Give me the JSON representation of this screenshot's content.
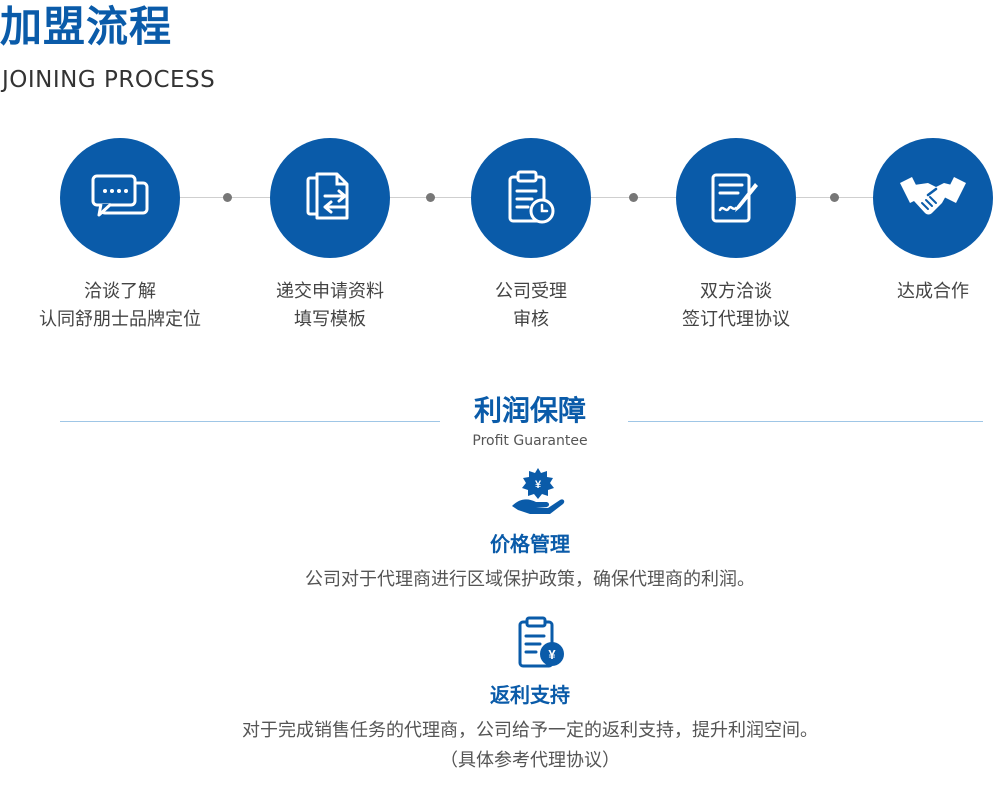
{
  "header": {
    "title_cn": "加盟流程",
    "title_en": "JOINING PROCESS"
  },
  "steps": [
    {
      "icon": "chat-bubbles-icon",
      "line1": "洽谈了解",
      "line2": "认同舒朋士品牌定位"
    },
    {
      "icon": "document-exchange-icon",
      "line1": "递交申请资料",
      "line2": "填写模板"
    },
    {
      "icon": "clipboard-clock-icon",
      "line1": "公司受理",
      "line2": "审核"
    },
    {
      "icon": "contract-sign-icon",
      "line1": "双方洽谈",
      "line2": "签订代理协议"
    },
    {
      "icon": "handshake-icon",
      "line1": "达成合作",
      "line2": ""
    }
  ],
  "profit": {
    "title_cn": "利润保障",
    "title_en": "Profit Guarantee",
    "items": [
      {
        "icon": "price-hand-icon",
        "title": "价格管理",
        "desc": [
          "公司对于代理商进行区域保护政策，确保代理商的利润。"
        ]
      },
      {
        "icon": "rebate-document-icon",
        "title": "返利支持",
        "desc": [
          "对于完成销售任务的代理商，公司给予一定的返利支持，提升利润空间。",
          "（具体参考代理协议）"
        ]
      }
    ]
  },
  "colors": {
    "brand": "#0a5ba9",
    "text": "#444444",
    "line": "#9fc6e6"
  }
}
